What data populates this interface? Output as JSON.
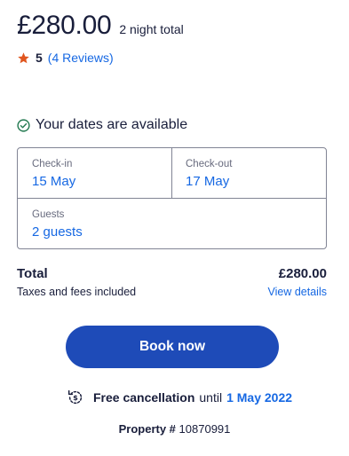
{
  "price": {
    "amount": "£280.00",
    "subtitle": "2 night total"
  },
  "rating": {
    "value": "5",
    "reviews_link": "(4 Reviews)",
    "star_color": "#e0561f"
  },
  "availability": {
    "text": "Your dates are available",
    "icon": "check-circle-icon",
    "color": "#227950"
  },
  "dates": {
    "checkin": {
      "label": "Check-in",
      "value": "15 May"
    },
    "checkout": {
      "label": "Check-out",
      "value": "17 May"
    },
    "guests": {
      "label": "Guests",
      "value": "2 guests"
    }
  },
  "total": {
    "label": "Total",
    "amount": "£280.00",
    "taxes": "Taxes and fees included",
    "details_link": "View details"
  },
  "book_button": {
    "label": "Book now",
    "color": "#1e4bb8"
  },
  "cancellation": {
    "icon": "refund-clock-icon",
    "strong": "Free cancellation",
    "until": "until",
    "date": "1 May 2022"
  },
  "property": {
    "label": "Property #",
    "number": "10870991"
  },
  "colors": {
    "link": "#1668e3",
    "text": "#191e3b",
    "border": "#818494"
  }
}
